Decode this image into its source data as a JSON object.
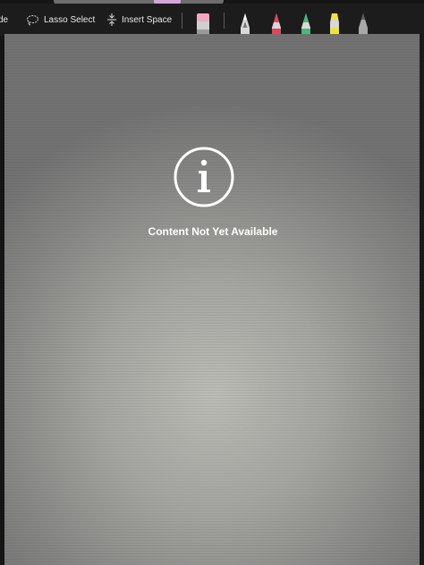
{
  "toolbar": {
    "mode_label": "de",
    "lasso_label": "Lasso Select",
    "insert_label": "Insert Space",
    "tools": [
      {
        "name": "eraser",
        "color": "#d9d9d9",
        "tip": "#f0a9c0"
      },
      {
        "name": "pen-white",
        "color": "#d8d8d8"
      },
      {
        "name": "pen-red",
        "color": "#e0455a"
      },
      {
        "name": "pen-green",
        "color": "#4fb37a"
      },
      {
        "name": "highlighter-yellow",
        "color": "#f2e33a"
      },
      {
        "name": "pencil-gray",
        "color": "#a8a8a8"
      }
    ]
  },
  "content": {
    "icon": "info-circle-icon",
    "message": "Content Not Yet Available"
  }
}
